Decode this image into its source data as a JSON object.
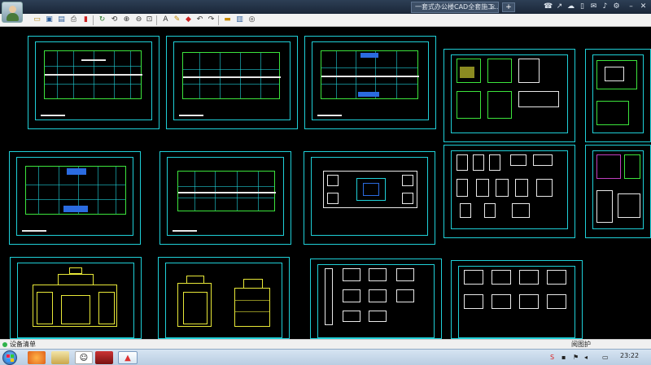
{
  "titlebar": {
    "tab_title": "一套式办公楼CAD全套施工...",
    "tab_close": "×",
    "tab_new": "+",
    "system_icons": [
      "phone-icon",
      "share-icon",
      "cloud-icon",
      "mobile-icon",
      "mail-icon",
      "bell-icon",
      "gear-icon"
    ]
  },
  "toolbar": {
    "icons": [
      "open-icon",
      "save-icon",
      "save-all-icon",
      "print-icon",
      "pdf-icon",
      "refresh-icon",
      "rotate-icon",
      "zoom-in-icon",
      "zoom-out-icon",
      "zoom-fit-icon",
      "text-icon",
      "pen-icon",
      "paint-icon",
      "undo-icon",
      "redo-icon",
      "layer-icon",
      "measure-icon",
      "settings-icon"
    ]
  },
  "status": {
    "text": "设备清单",
    "right_label": "阅图护"
  },
  "taskbar": {
    "clock": "23:22",
    "apps": [
      "browser-app",
      "explorer-app",
      "chat-app",
      "library-app",
      "cad-app"
    ],
    "tray_icons": [
      "sogou-icon",
      "volume-icon",
      "network-icon",
      "flag-icon"
    ]
  },
  "colors": {
    "sheet_border": "#1fd0d8",
    "plan_lines": "#3ce43c",
    "elevation_lines": "#e8e838",
    "hatch_blue": "#2b6be0"
  }
}
